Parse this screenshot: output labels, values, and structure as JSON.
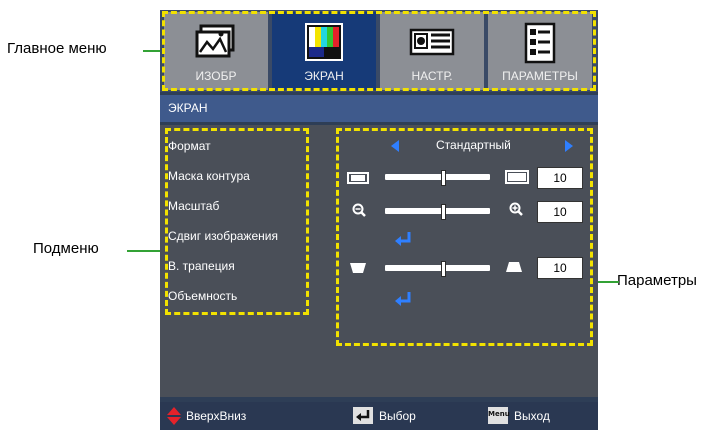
{
  "callouts": {
    "main_menu": "Главное меню",
    "submenu": "Подменю",
    "parameters": "Параметры"
  },
  "tabs": [
    {
      "label": "ИЗОБР",
      "icon": "image-icon",
      "active": false
    },
    {
      "label": "ЭКРАН",
      "icon": "test-pattern-icon",
      "active": true
    },
    {
      "label": "НАСТР.",
      "icon": "projector-icon",
      "active": false
    },
    {
      "label": "ПАРАМЕТРЫ",
      "icon": "settings-list-icon",
      "active": false
    }
  ],
  "section_title": "ЭКРАН",
  "menu": {
    "items": [
      "Формат",
      "Маска контура",
      "Масштаб",
      "Сдвиг изображения",
      "В. трапеция",
      "Объемность"
    ]
  },
  "params": {
    "format_value": "Стандартный",
    "edge_mask_value": "10",
    "zoom_value": "10",
    "v_keystone_value": "10"
  },
  "footer": {
    "updown": "ВверхВниз",
    "select": "Выбор",
    "menu_key": "Menu",
    "exit": "Выход"
  },
  "colors": {
    "accent_yellow": "#f2e200",
    "callout_green": "#33a235",
    "active_tab": "#163a78",
    "arrow_blue": "#2f7fff"
  }
}
